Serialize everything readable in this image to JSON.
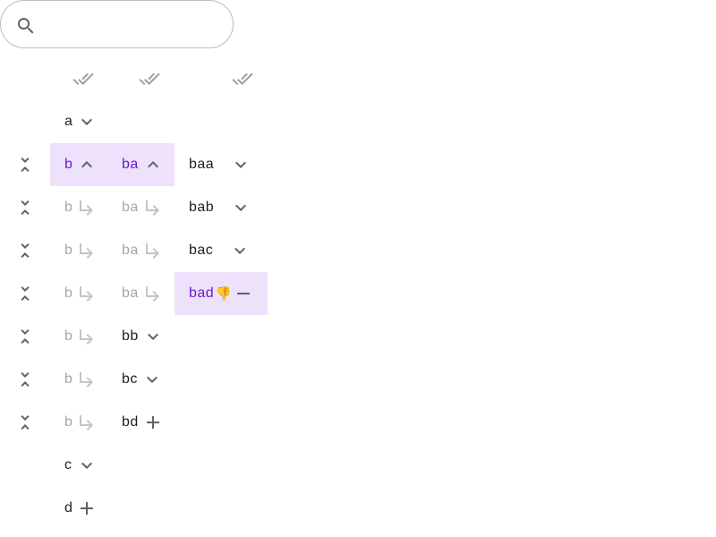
{
  "search": {
    "value": "",
    "placeholder": ""
  },
  "tree": {
    "a": "a",
    "b": "b",
    "c": "c",
    "d": "d",
    "ba": "ba",
    "bb": "bb",
    "bc": "bc",
    "bd": "bd",
    "baa": "baa",
    "bab": "bab",
    "bac": "bac",
    "bad": "bad",
    "bad_emoji": "👎"
  },
  "icons": {
    "search": "search-icon",
    "column_check": "done-all-icon",
    "row_collapse": "collapse-rows-icon",
    "expand": "chevron-down-icon",
    "collapse": "chevron-up-icon",
    "leaf_add": "plus-icon",
    "leaf_remove": "minus-icon",
    "repeat": "subdirectory-arrow-icon"
  },
  "colors": {
    "selected_bg": "#ede1fb",
    "selected_text": "#6a1ad7",
    "dim_text": "#a6a6a6",
    "icon": "#5f6368"
  }
}
